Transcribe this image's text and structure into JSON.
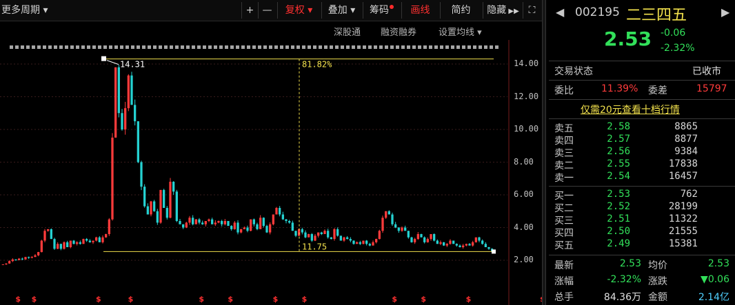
{
  "toolbar": {
    "period_label": "更多周期",
    "zoom_in": "+",
    "zoom_out": "—",
    "restore_label": "复权",
    "overlay_label": "叠加",
    "chips_label": "筹码",
    "draw_label": "画线",
    "simple_label": "简约",
    "hide_label": "隐藏",
    "expand_glyph": "⛶"
  },
  "subbar": {
    "items": [
      "深股通",
      "融资融券",
      "设置均线"
    ]
  },
  "chart_data": {
    "type": "candlestick",
    "ylim": [
      1.6,
      14.9
    ],
    "y_ticks": [
      "14.00",
      "12.00",
      "10.00",
      "8.00",
      "6.00",
      "4.00",
      "2.00"
    ],
    "annotations": {
      "high_label": "14.31",
      "low_label": "11.75",
      "pct_label": "81.82%",
      "high_value": 14.31,
      "low_value": 2.53
    },
    "price_series": [
      1.75,
      1.8,
      1.95,
      2.05,
      2.0,
      2.1,
      2.05,
      2.2,
      2.15,
      2.2,
      2.3,
      2.5,
      3.2,
      3.8,
      3.9,
      3.3,
      2.7,
      3.0,
      2.7,
      3.1,
      2.8,
      3.2,
      3.0,
      3.1,
      3.0,
      3.3,
      3.2,
      3.1,
      3.2,
      3.4,
      3.1,
      3.4,
      3.6,
      4.5,
      9.5,
      13.8,
      11.0,
      10.0,
      11.3,
      13.3,
      11.5,
      10.5,
      8.0,
      6.5,
      5.3,
      4.8,
      5.6,
      5.0,
      4.3,
      6.3,
      5.2,
      4.6,
      6.8,
      6.2,
      4.4,
      4.2,
      4.0,
      4.3,
      4.6,
      4.2,
      4.5,
      4.3,
      4.2,
      4.4,
      4.5,
      4.2,
      4.3,
      4.4,
      4.2,
      4.4,
      4.1,
      3.9,
      4.3,
      3.7,
      3.9,
      4.0,
      3.8,
      4.5,
      4.2,
      3.9,
      4.6,
      4.1,
      3.7,
      4.2,
      4.8,
      5.2,
      4.8,
      4.5,
      4.4,
      4.3,
      3.8,
      3.5,
      3.9,
      3.7,
      3.4,
      3.6,
      3.2,
      3.5,
      3.7,
      3.6,
      3.8,
      3.4,
      3.3,
      3.9,
      3.5,
      3.2,
      3.4,
      3.3,
      3.2,
      3.0,
      3.1,
      3.0,
      3.2,
      3.0,
      2.9,
      3.1,
      3.3,
      3.8,
      4.6,
      5.0,
      4.8,
      4.2,
      4.0,
      3.8,
      4.0,
      3.8,
      3.4,
      3.1,
      3.3,
      3.6,
      3.4,
      3.1,
      3.3,
      3.6,
      3.2,
      3.0,
      3.1,
      2.9,
      3.0,
      3.2,
      3.0,
      2.9,
      2.8,
      2.9,
      3.0,
      2.9,
      3.1,
      3.4,
      3.2,
      3.0,
      2.8,
      2.7,
      2.55
    ],
    "dividend_marker_positions": [
      5,
      10,
      30,
      40,
      62,
      71,
      85,
      94,
      122,
      131,
      145,
      168,
      182
    ]
  },
  "panel": {
    "code": "002195",
    "name": "二三四五",
    "price": "2.53",
    "change": "-0.06",
    "change_pct": "-2.32%",
    "status_label": "交易状态",
    "status_value": "已收市",
    "ratio_label": "委比",
    "ratio_value": "11.39%",
    "diff_label": "委差",
    "diff_value": "15797",
    "promo": "仅需20元查看十档行情",
    "asks": [
      {
        "label": "卖五",
        "price": "2.58",
        "vol": "8865"
      },
      {
        "label": "卖四",
        "price": "2.57",
        "vol": "8877"
      },
      {
        "label": "卖三",
        "price": "2.56",
        "vol": "9384"
      },
      {
        "label": "卖二",
        "price": "2.55",
        "vol": "17838"
      },
      {
        "label": "卖一",
        "price": "2.54",
        "vol": "16457"
      }
    ],
    "bids": [
      {
        "label": "买一",
        "price": "2.53",
        "vol": "762"
      },
      {
        "label": "买二",
        "price": "2.52",
        "vol": "28199"
      },
      {
        "label": "买三",
        "price": "2.51",
        "vol": "11322"
      },
      {
        "label": "买四",
        "price": "2.50",
        "vol": "21555"
      },
      {
        "label": "买五",
        "price": "2.49",
        "vol": "15381"
      }
    ],
    "stats": {
      "latest_label": "最新",
      "latest_value": "2.53",
      "avg_label": "均价",
      "avg_value": "2.53",
      "pct_label": "涨幅",
      "pct_value": "-2.32%",
      "chg_label": "涨跌",
      "chg_value": "▼0.06",
      "vol_label": "总手",
      "vol_value": "84.36万",
      "amt_label": "金额",
      "amt_value": "2.14亿"
    }
  },
  "colors": {
    "up": "#ff3b3b",
    "down": "#25d2d2",
    "accent_line": "#f2e14c",
    "price_green": "#32e05a"
  }
}
